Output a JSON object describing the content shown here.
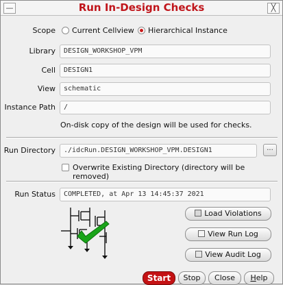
{
  "window": {
    "title": "Run In-Design Checks",
    "left_button": "—",
    "close_button": "╳"
  },
  "scope": {
    "label": "Scope",
    "options": [
      {
        "label": "Current Cellview",
        "selected": false
      },
      {
        "label": "Hierarchical Instance",
        "selected": true
      }
    ]
  },
  "fields": {
    "library": {
      "label": "Library",
      "value": "DESIGN_WORKSHOP_VPM"
    },
    "cell": {
      "label": "Cell",
      "value": "DESIGN1"
    },
    "view": {
      "label": "View",
      "value": "schematic"
    },
    "instance_path": {
      "label": "Instance Path",
      "value": "/"
    }
  },
  "ondisk_note": "On-disk copy of the design will be used for checks.",
  "run_directory": {
    "label": "Run Directory",
    "value": "./idcRun.DESIGN_WORKSHOP_VPM.DESIGN1",
    "browse_label": "..."
  },
  "overwrite": {
    "label": "Overwrite Existing Directory (directory will be removed)",
    "checked": false
  },
  "run_status": {
    "label": "Run Status",
    "value": "COMPLETED, at Apr 13 14:45:37 2021"
  },
  "actions": {
    "load_violations": "Load Violations",
    "view_run_log": "View Run Log",
    "view_audit_log": "View Audit Log"
  },
  "footer": {
    "start": "Start",
    "stop": "Stop",
    "close": "Close",
    "help_first": "H",
    "help_rest": "elp"
  },
  "colors": {
    "title": "#c0151b",
    "accent": "#c41214",
    "check": "#1aa51a"
  },
  "icons": {
    "status_graphic": "schematic-checkmark-icon"
  }
}
